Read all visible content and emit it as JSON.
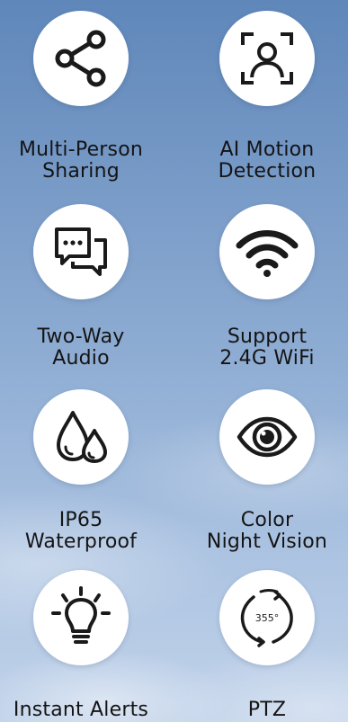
{
  "features": [
    {
      "icon": "share-icon",
      "label_lines": [
        "Multi-Person",
        "Sharing"
      ]
    },
    {
      "icon": "face-scan-icon",
      "label_lines": [
        "AI Motion",
        "Detection"
      ]
    },
    {
      "icon": "chat-bubbles-icon",
      "label_lines": [
        "Two-Way",
        "Audio"
      ]
    },
    {
      "icon": "wifi-icon",
      "label_lines": [
        "Support",
        "2.4G WiFi"
      ]
    },
    {
      "icon": "water-drops-icon",
      "label_lines": [
        "IP65",
        "Waterproof"
      ]
    },
    {
      "icon": "eye-icon",
      "label_lines": [
        "Color",
        "Night Vision"
      ]
    },
    {
      "icon": "light-bulb-icon",
      "label_lines": [
        "Instant Alerts",
        ""
      ]
    },
    {
      "icon": "rotate-355-icon",
      "label_lines": [
        "PTZ",
        ""
      ],
      "badge": "355°"
    }
  ],
  "colors": {
    "circle": "#ffffff",
    "icon": "#1a1a1a",
    "text": "#141414"
  }
}
